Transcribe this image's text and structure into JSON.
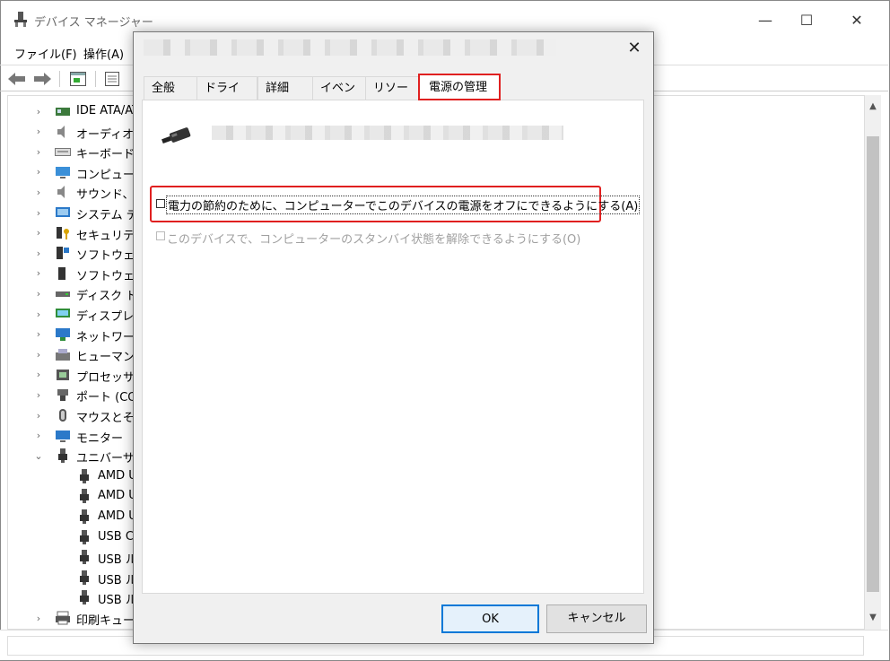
{
  "window": {
    "title": "デバイス マネージャー",
    "caption": {
      "minimize": "—",
      "maximize": "☐",
      "close": "✕"
    }
  },
  "menu": {
    "file": "ファイル(F)",
    "action": "操作(A)"
  },
  "tree": {
    "categories": [
      {
        "label": "IDE ATA/ATAPI",
        "icon": "ide-controller-icon"
      },
      {
        "label": "オーディオの",
        "icon": "speaker-icon"
      },
      {
        "label": "キーボード",
        "icon": "keyboard-icon"
      },
      {
        "label": "コンピューター",
        "icon": "computer-icon"
      },
      {
        "label": "サウンド、ビ",
        "icon": "speaker-icon"
      },
      {
        "label": "システム デバ",
        "icon": "system-icon"
      },
      {
        "label": "セキュリティ",
        "icon": "security-key-icon"
      },
      {
        "label": "ソフトウェア",
        "icon": "software-component-icon"
      },
      {
        "label": "ソフトウェア",
        "icon": "software-device-icon"
      },
      {
        "label": "ディスク ドラ",
        "icon": "disk-drive-icon"
      },
      {
        "label": "ディスプレイ",
        "icon": "display-adapter-icon"
      },
      {
        "label": "ネットワーク",
        "icon": "network-icon"
      },
      {
        "label": "ヒューマン イ",
        "icon": "hid-icon"
      },
      {
        "label": "プロセッサ",
        "icon": "processor-icon"
      },
      {
        "label": "ポート (COM",
        "icon": "port-icon"
      },
      {
        "label": "マウスとその",
        "icon": "mouse-icon"
      },
      {
        "label": "モニター",
        "icon": "monitor-icon"
      },
      {
        "label": "ユニバーサル",
        "icon": "usb-icon",
        "expanded": true
      }
    ],
    "usb_children": [
      "AMD U",
      "AMD U",
      "AMD U",
      "USB C",
      "USB ル",
      "USB ル",
      "USB ル"
    ],
    "last": {
      "label": "印刷キュー",
      "icon": "printer-icon"
    }
  },
  "dialog": {
    "close": "✕",
    "tabs": [
      "全般",
      "ドライバー",
      "詳細",
      "イベント",
      "リソース",
      "電源の管理"
    ],
    "active_tab": "電源の管理",
    "options": {
      "allow_power_off": {
        "label": "電力の節約のために、コンピューターでこのデバイスの電源をオフにできるようにする(A)",
        "checked": false,
        "enabled": true
      },
      "allow_wake": {
        "label": "このデバイスで、コンピューターのスタンバイ状態を解除できるようにする(O)",
        "checked": false,
        "enabled": false
      }
    },
    "buttons": {
      "ok": "OK",
      "cancel": "キャンセル"
    }
  },
  "colors": {
    "highlight": "#e02020",
    "accent": "#0078d7"
  }
}
